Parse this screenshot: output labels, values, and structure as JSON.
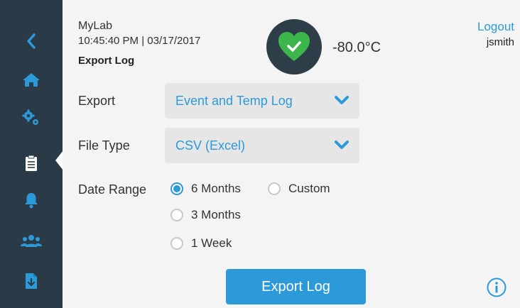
{
  "header": {
    "app_name": "MyLab",
    "datetime": "10:45:40 PM | 03/17/2017",
    "page_title": "Export Log",
    "temperature": "-80.0°C",
    "logout_label": "Logout",
    "username": "jsmith"
  },
  "sidebar": {
    "items": [
      {
        "icon": "back-chevron-icon"
      },
      {
        "icon": "home-icon"
      },
      {
        "icon": "gears-icon"
      },
      {
        "icon": "clipboard-icon",
        "active": true
      },
      {
        "icon": "bell-icon"
      },
      {
        "icon": "users-icon"
      },
      {
        "icon": "file-download-icon"
      }
    ]
  },
  "form": {
    "export_label": "Export",
    "export_value": "Event and Temp Log",
    "file_type_label": "File Type",
    "file_type_value": "CSV (Excel)",
    "date_range_label": "Date Range",
    "date_options": [
      {
        "label": "6 Months",
        "checked": true
      },
      {
        "label": "Custom",
        "checked": false
      },
      {
        "label": "3 Months",
        "checked": false
      },
      {
        "label": "1 Week",
        "checked": false
      }
    ]
  },
  "actions": {
    "export_button_label": "Export Log",
    "info_icon": "info-icon"
  },
  "colors": {
    "sidebar_bg": "#2a3b47",
    "accent_blue": "#2c9ad8",
    "status_green": "#3cb54a",
    "main_bg": "#f4f4f4"
  }
}
